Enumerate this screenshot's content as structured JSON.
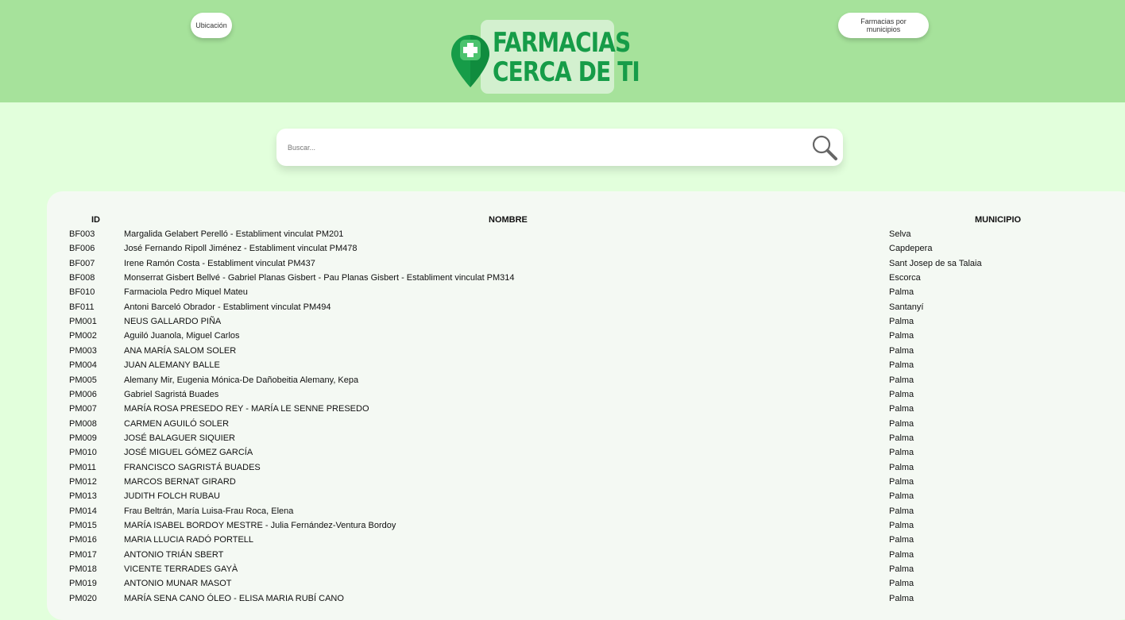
{
  "nav": {
    "ubicacion_label": "Ubicación",
    "municipios_label": "Farmacias por municipios"
  },
  "logo": {
    "line1": "FARMACIAS",
    "line2": "CERCA DE TI",
    "icon": "map-pin-cross-icon"
  },
  "search": {
    "placeholder": "Buscar...",
    "icon": "magnifier-icon"
  },
  "colors": {
    "header": "#a6e29b",
    "background": "#e2ffdc",
    "panel": "#f4f9f3",
    "brand_green": "#169c48"
  },
  "table": {
    "headers": {
      "id": "ID",
      "nombre": "NOMBRE",
      "municipio": "MUNICIPIO"
    },
    "rows": [
      {
        "id": "BF003",
        "nombre": "Margalida Gelabert Perelló - Establiment vinculat PM201",
        "municipio": "Selva"
      },
      {
        "id": "BF006",
        "nombre": "José Fernando Ripoll Jiménez - Establiment vinculat PM478",
        "municipio": "Capdepera"
      },
      {
        "id": "BF007",
        "nombre": "Irene Ramón Costa - Establiment vinculat PM437",
        "municipio": "Sant Josep de sa Talaia"
      },
      {
        "id": "BF008",
        "nombre": "Monserrat Gisbert Bellvé - Gabriel Planas Gisbert - Pau Planas Gisbert - Establiment vinculat PM314",
        "municipio": "Escorca"
      },
      {
        "id": "BF010",
        "nombre": "Farmaciola Pedro Miquel Mateu",
        "municipio": "Palma"
      },
      {
        "id": "BF011",
        "nombre": "Antoni Barceló Obrador - Establiment vinculat PM494",
        "municipio": "Santanyí"
      },
      {
        "id": "PM001",
        "nombre": "NEUS GALLARDO PIÑA",
        "municipio": "Palma"
      },
      {
        "id": "PM002",
        "nombre": "Aguiló Juanola, Miguel Carlos",
        "municipio": "Palma"
      },
      {
        "id": "PM003",
        "nombre": "ANA MARÍA SALOM SOLER",
        "municipio": "Palma"
      },
      {
        "id": "PM004",
        "nombre": "JUAN ALEMANY BALLE",
        "municipio": "Palma"
      },
      {
        "id": "PM005",
        "nombre": "Alemany Mir, Eugenia Mónica-De Dañobeitia Alemany, Kepa",
        "municipio": "Palma"
      },
      {
        "id": "PM006",
        "nombre": "Gabriel Sagristá Buades",
        "municipio": "Palma"
      },
      {
        "id": "PM007",
        "nombre": "MARÍA ROSA PRESEDO REY - MARÍA LE SENNE PRESEDO",
        "municipio": "Palma"
      },
      {
        "id": "PM008",
        "nombre": "CARMEN AGUILÓ SOLER",
        "municipio": "Palma"
      },
      {
        "id": "PM009",
        "nombre": "JOSÉ BALAGUER SIQUIER",
        "municipio": "Palma"
      },
      {
        "id": "PM010",
        "nombre": "JOSÉ MIGUEL GÓMEZ GARCÍA",
        "municipio": "Palma"
      },
      {
        "id": "PM011",
        "nombre": "FRANCISCO SAGRISTÁ BUADES",
        "municipio": "Palma"
      },
      {
        "id": "PM012",
        "nombre": "MARCOS BERNAT GIRARD",
        "municipio": "Palma"
      },
      {
        "id": "PM013",
        "nombre": "JUDITH FOLCH RUBAU",
        "municipio": "Palma"
      },
      {
        "id": "PM014",
        "nombre": "Frau Beltrán, María Luisa-Frau Roca, Elena",
        "municipio": "Palma"
      },
      {
        "id": "PM015",
        "nombre": "MARÍA ISABEL BORDOY MESTRE - Julia Fernández-Ventura Bordoy",
        "municipio": "Palma"
      },
      {
        "id": "PM016",
        "nombre": "MARIA LLUCIA RADÓ PORTELL",
        "municipio": "Palma"
      },
      {
        "id": "PM017",
        "nombre": "ANTONIO TRIÁN SBERT",
        "municipio": "Palma"
      },
      {
        "id": "PM018",
        "nombre": "VICENTE TERRADES GAYÀ",
        "municipio": "Palma"
      },
      {
        "id": "PM019",
        "nombre": "ANTONIO MUNAR MASOT",
        "municipio": "Palma"
      },
      {
        "id": "PM020",
        "nombre": "MARÍA SENA CANO ÓLEO - ELISA MARIA RUBÍ CANO",
        "municipio": "Palma"
      }
    ]
  }
}
